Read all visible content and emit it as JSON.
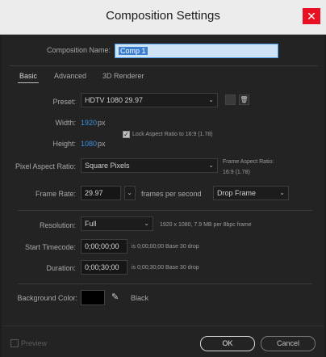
{
  "window": {
    "title": "Composition Settings",
    "close_glyph": "✕"
  },
  "composition_name": {
    "label": "Composition Name:",
    "value": "Comp 1"
  },
  "tabs": [
    {
      "label": "Basic",
      "active": true
    },
    {
      "label": "Advanced",
      "active": false
    },
    {
      "label": "3D Renderer",
      "active": false
    }
  ],
  "preset": {
    "label": "Preset:",
    "value": "HDTV 1080 29.97"
  },
  "width": {
    "label": "Width:",
    "value": "1920",
    "unit": "px"
  },
  "height": {
    "label": "Height:",
    "value": "1080",
    "unit": "px"
  },
  "lock_aspect": {
    "label": "Lock Aspect Ratio to 16:9 (1.78)",
    "checked": true
  },
  "pixel_aspect": {
    "label": "Pixel Aspect Ratio:",
    "value": "Square Pixels"
  },
  "frame_aspect": {
    "label": "Frame Aspect Ratio:",
    "value": "16:9 (1.78)"
  },
  "frame_rate": {
    "label": "Frame Rate:",
    "value": "29.97",
    "unit": "frames per second",
    "drop": "Drop Frame"
  },
  "resolution": {
    "label": "Resolution:",
    "value": "Full",
    "info": "1920 x 1080, 7.9 MB per 8bpc frame"
  },
  "start_timecode": {
    "label": "Start Timecode:",
    "value": "0;00;00;00",
    "info": "is 0;00;00;00  Base 30  drop"
  },
  "duration": {
    "label": "Duration:",
    "value": "0;00;30;00",
    "info": "is 0;00;30;00  Base 30  drop"
  },
  "background": {
    "label": "Background Color:",
    "name": "Black",
    "color": "#000000"
  },
  "footer": {
    "preview_label": "Preview",
    "ok_label": "OK",
    "cancel_label": "Cancel"
  },
  "colors": {
    "accent_blue": "#3c8fe0",
    "close_red": "#e81123"
  }
}
